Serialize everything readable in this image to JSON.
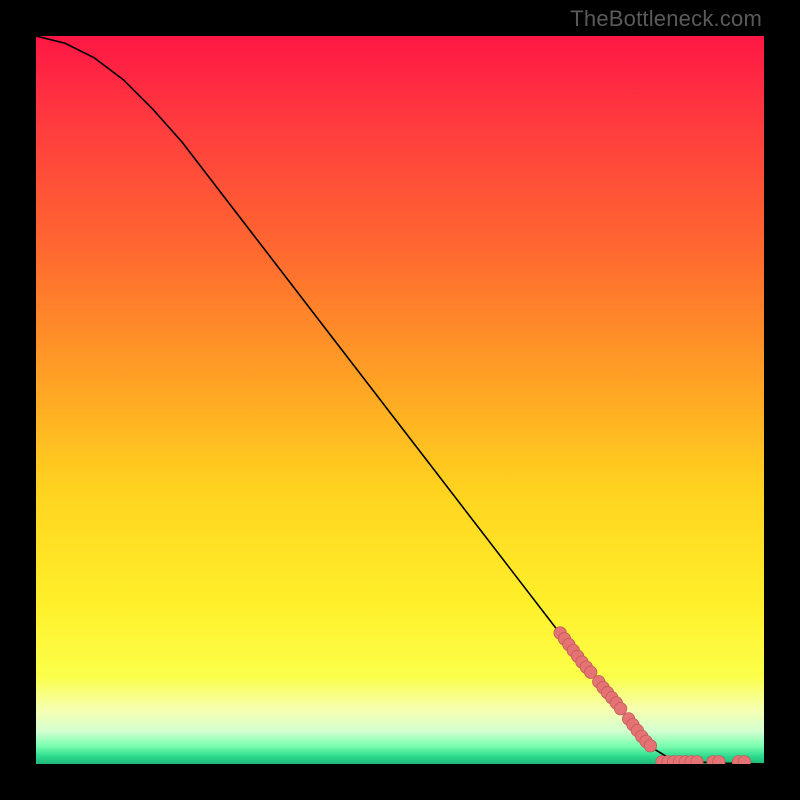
{
  "watermark": "TheBottleneck.com",
  "colors": {
    "bg_black": "#000000",
    "curve": "#000000",
    "marker_fill": "#e57373",
    "marker_stroke": "#c15b5b",
    "gradient_stops": [
      {
        "offset": 0.0,
        "color": "#ff1744"
      },
      {
        "offset": 0.12,
        "color": "#ff3b3f"
      },
      {
        "offset": 0.3,
        "color": "#ff6a2f"
      },
      {
        "offset": 0.48,
        "color": "#ffa424"
      },
      {
        "offset": 0.62,
        "color": "#ffd21f"
      },
      {
        "offset": 0.78,
        "color": "#fff02a"
      },
      {
        "offset": 0.88,
        "color": "#fbff4a"
      },
      {
        "offset": 0.925,
        "color": "#f6ffb0"
      },
      {
        "offset": 0.955,
        "color": "#d4ffd0"
      },
      {
        "offset": 0.975,
        "color": "#7affb0"
      },
      {
        "offset": 0.99,
        "color": "#2bd98c"
      },
      {
        "offset": 1.0,
        "color": "#1fb978"
      }
    ]
  },
  "chart_data": {
    "type": "line",
    "title": "",
    "xlabel": "",
    "ylabel": "",
    "xlim": [
      0,
      100
    ],
    "ylim": [
      0,
      100
    ],
    "grid": false,
    "curve": [
      {
        "x": 0,
        "y": 100
      },
      {
        "x": 4,
        "y": 99
      },
      {
        "x": 8,
        "y": 97
      },
      {
        "x": 12,
        "y": 94
      },
      {
        "x": 16,
        "y": 90
      },
      {
        "x": 20,
        "y": 85.5
      },
      {
        "x": 25,
        "y": 79
      },
      {
        "x": 30,
        "y": 72.5
      },
      {
        "x": 35,
        "y": 66
      },
      {
        "x": 40,
        "y": 59.5
      },
      {
        "x": 45,
        "y": 53
      },
      {
        "x": 50,
        "y": 46.5
      },
      {
        "x": 55,
        "y": 40
      },
      {
        "x": 60,
        "y": 33.5
      },
      {
        "x": 65,
        "y": 27
      },
      {
        "x": 70,
        "y": 20.5
      },
      {
        "x": 75,
        "y": 14
      },
      {
        "x": 80,
        "y": 8
      },
      {
        "x": 83,
        "y": 4
      },
      {
        "x": 85,
        "y": 2
      },
      {
        "x": 87,
        "y": 0.8
      },
      {
        "x": 90,
        "y": 0.3
      },
      {
        "x": 95,
        "y": 0.1
      },
      {
        "x": 100,
        "y": 0
      }
    ],
    "markers_on_curve": [
      {
        "x": 72,
        "y": 18.0
      },
      {
        "x": 72.6,
        "y": 17.2
      },
      {
        "x": 73.2,
        "y": 16.4
      },
      {
        "x": 73.8,
        "y": 15.6
      },
      {
        "x": 74.4,
        "y": 14.8
      },
      {
        "x": 75.0,
        "y": 14.0
      },
      {
        "x": 75.6,
        "y": 13.3
      },
      {
        "x": 76.2,
        "y": 12.6
      },
      {
        "x": 77.3,
        "y": 11.3
      },
      {
        "x": 77.9,
        "y": 10.5
      },
      {
        "x": 78.5,
        "y": 9.8
      },
      {
        "x": 79.1,
        "y": 9.1
      },
      {
        "x": 79.7,
        "y": 8.4
      },
      {
        "x": 80.3,
        "y": 7.6
      },
      {
        "x": 81.4,
        "y": 6.2
      },
      {
        "x": 82.0,
        "y": 5.4
      },
      {
        "x": 82.6,
        "y": 4.6
      },
      {
        "x": 83.2,
        "y": 3.8
      },
      {
        "x": 83.8,
        "y": 3.1
      },
      {
        "x": 84.4,
        "y": 2.5
      }
    ],
    "markers_bottom": [
      {
        "x": 86.0,
        "y": 0.3
      },
      {
        "x": 86.8,
        "y": 0.3
      },
      {
        "x": 87.6,
        "y": 0.3
      },
      {
        "x": 88.4,
        "y": 0.3
      },
      {
        "x": 89.2,
        "y": 0.3
      },
      {
        "x": 90.0,
        "y": 0.3
      },
      {
        "x": 90.8,
        "y": 0.3
      },
      {
        "x": 93.0,
        "y": 0.3
      },
      {
        "x": 93.8,
        "y": 0.3
      },
      {
        "x": 96.5,
        "y": 0.3
      },
      {
        "x": 97.3,
        "y": 0.3
      }
    ]
  }
}
